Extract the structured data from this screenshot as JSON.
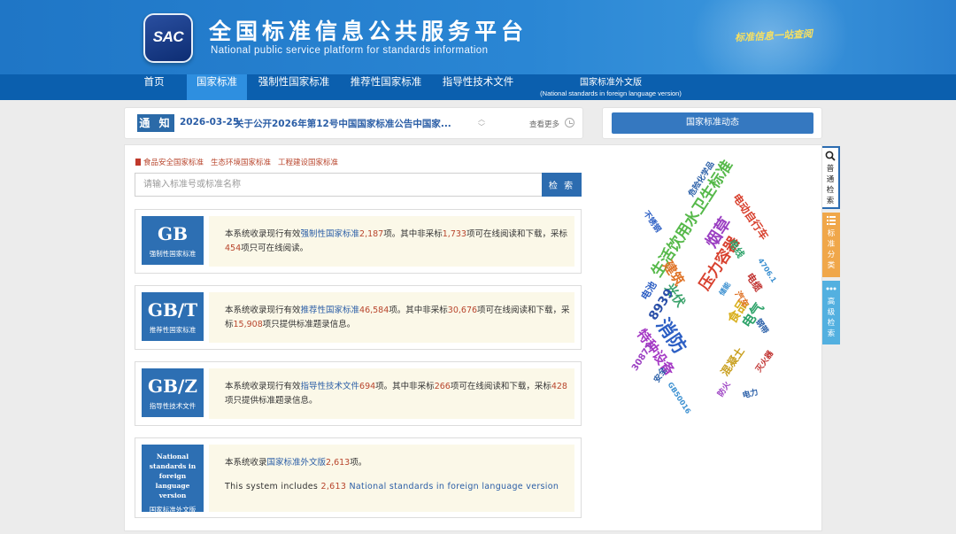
{
  "header": {
    "logo_text": "SAC",
    "title": "全国标准信息公共服务平台",
    "subtitle": "National public service platform  for standards information",
    "slogan": "标准信息一站查阅"
  },
  "nav": {
    "items": [
      "首页",
      "国家标准",
      "强制性国家标准",
      "推荐性国家标准",
      "指导性技术文件"
    ],
    "active_index": 1,
    "foreign_line1": "国家标准外文版",
    "foreign_line2": "(National standards in foreign language version)"
  },
  "notice": {
    "tag": "通 知",
    "date": "2026-03-25",
    "text": "关于公开2026年第12号中国国家标准公告中国家...",
    "more": "查看更多"
  },
  "dynamics": {
    "button": "国家标准动态"
  },
  "search": {
    "quick_links": [
      "食品安全国家标准",
      "生态环境国家标准",
      "工程建设国家标准"
    ],
    "placeholder": "请输入标准号或标准名称",
    "button": "检 索"
  },
  "standards": [
    {
      "code": "GB",
      "name": "强制性国家标准",
      "t1": "本系统收录现行有效",
      "link": "强制性国家标准",
      "total": "2,187",
      "t2": "项。其中非采标",
      "nonadopt": "1,733",
      "t3": "项可在线阅读和下载，采标",
      "adopt": "454",
      "t4": "项只可在线阅读。"
    },
    {
      "code": "GB/T",
      "name": "推荐性国家标准",
      "t1": "本系统收录现行有效",
      "link": "推荐性国家标准",
      "total": "46,584",
      "t2": "项。其中非采标",
      "nonadopt": "30,676",
      "t3": "项可在线阅读和下载，采标",
      "adopt": "15,908",
      "t4": "项只提供标准题录信息。"
    },
    {
      "code": "GB/Z",
      "name": "指导性技术文件",
      "t1": "本系统收录现行有效",
      "link": "指导性技术文件",
      "total": "694",
      "t2": "项。其中非采标",
      "nonadopt": "266",
      "t3": "项可在线阅读和下载，采标",
      "adopt": "428",
      "t4": "项只提供标准题录信息。"
    }
  ],
  "foreign": {
    "badge_en": "National standards in foreign language version",
    "badge_cn": "国家标准外文版",
    "cn_t1": "本系统收录",
    "cn_link": "国家标准外文版",
    "cn_count": "2,613",
    "cn_t2": "项。",
    "en_t1": "This system includes ",
    "en_count": "2,613",
    "en_t2": " National standards in foreign language version"
  },
  "word_cloud": [
    {
      "text": "生活饮用水卫生标准",
      "color": "#56b94a"
    },
    {
      "text": "消防",
      "color": "#2d5fc4"
    },
    {
      "text": "烟草",
      "color": "#9b3fc2"
    },
    {
      "text": "压力容器",
      "color": "#d8402e"
    },
    {
      "text": "特种设备",
      "color": "#a53ac5"
    },
    {
      "text": "建筑",
      "color": "#e0752a"
    },
    {
      "text": "光伏",
      "color": "#3aa26a"
    },
    {
      "text": "电气",
      "color": "#2ea36a"
    },
    {
      "text": "食品",
      "color": "#d9b020"
    },
    {
      "text": "8939",
      "color": "#2a4fa8"
    },
    {
      "text": "混凝土",
      "color": "#c9a020"
    },
    {
      "text": "电动自行车",
      "color": "#d8402e"
    },
    {
      "text": "危险化学品",
      "color": "#2a5fa8"
    },
    {
      "text": "电线",
      "color": "#2ea36a"
    },
    {
      "text": "电缆",
      "color": "#c0302e"
    },
    {
      "text": "电池",
      "color": "#2d5fc4"
    },
    {
      "text": "汽车",
      "color": "#e0752a"
    },
    {
      "text": "钢带",
      "color": "#2a5fa8"
    },
    {
      "text": "灭火器",
      "color": "#c0302e"
    },
    {
      "text": "不锈钢",
      "color": "#2d5fc4"
    },
    {
      "text": "30871",
      "color": "#9b3fc2"
    },
    {
      "text": "安全",
      "color": "#2a5fa8"
    },
    {
      "text": "GB50016",
      "color": "#3a8fd0"
    },
    {
      "text": "防火",
      "color": "#9b3fc2"
    },
    {
      "text": "电力",
      "color": "#2a5fa8"
    },
    {
      "text": "4706.1",
      "color": "#3a8fd0"
    },
    {
      "text": "储能",
      "color": "#3a8fd0"
    }
  ],
  "side_tabs": [
    {
      "label": "普通检索",
      "icon": "search-icon"
    },
    {
      "label": "标准分类",
      "icon": "list-icon"
    },
    {
      "label": "高级检索",
      "icon": "dots-icon"
    }
  ]
}
